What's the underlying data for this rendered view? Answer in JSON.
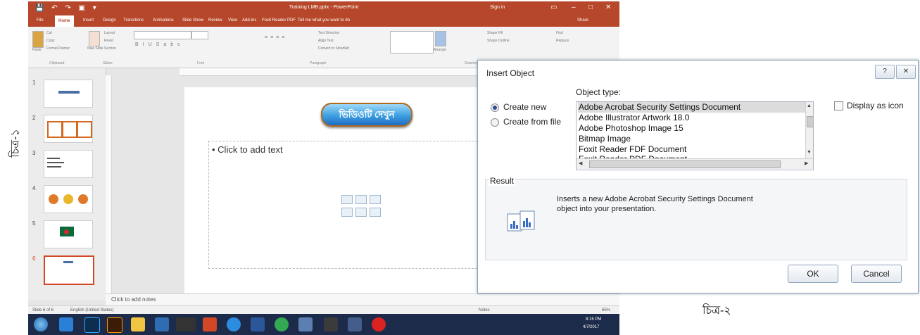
{
  "captions": {
    "fig1": "চিত্র-১",
    "fig2": "চিত্র-২"
  },
  "powerpoint": {
    "window_title": "Training LMB.pptx - PowerPoint",
    "sign_in": "Sign in",
    "tabs": [
      "File",
      "Home",
      "Insert",
      "Design",
      "Transitions",
      "Animations",
      "Slide Show",
      "Review",
      "View",
      "Add-ins",
      "Foxit Reader PDF",
      "Tell me what you want to do"
    ],
    "share": "Share",
    "ribbon": {
      "clipboard": {
        "cut": "Cut",
        "copy": "Copy",
        "format_painter": "Format Painter",
        "paste": "Paste",
        "label": "Clipboard"
      },
      "slides": {
        "new_slide": "New Slide",
        "layout": "Layout",
        "reset": "Reset",
        "section": "Section",
        "label": "Slides"
      },
      "font_label": "Font",
      "paragraph": {
        "text_direction": "Text Direction",
        "align_text": "Align Text",
        "convert_smartart": "Convert to SmartArt",
        "label": "Paragraph"
      },
      "drawing": {
        "arrange": "Arrange",
        "shape_fill": "Shape Fill",
        "shape_outline": "Shape Outline",
        "label": "Drawing"
      },
      "editing": {
        "find": "Find",
        "replace": "Replace"
      }
    },
    "slide_numbers": [
      "1",
      "2",
      "3",
      "4",
      "5",
      "6"
    ],
    "slide": {
      "video_button": "ভিডিওটি দেখুন",
      "placeholder_text": "• Click to add text"
    },
    "notes_placeholder": "Click to add notes",
    "status": {
      "slide_count": "Slide 6 of 6",
      "language": "English (United States)",
      "notes": "Notes",
      "zoom": "65%"
    },
    "taskbar_time": "8:15 PM",
    "taskbar_date": "4/7/2017"
  },
  "dialog": {
    "title": "Insert Object",
    "help_icon": "?",
    "object_type_label": "Object type:",
    "radio_create_new": "Create new",
    "radio_create_from_file": "Create from file",
    "display_as_icon": "Display as icon",
    "object_types": [
      "Adobe Acrobat Security Settings Document",
      "Adobe Illustrator Artwork 18.0",
      "Adobe Photoshop Image 15",
      "Bitmap Image",
      "Foxit Reader FDF Document",
      "Foxit Reader PDF Document"
    ],
    "selected_index": 0,
    "result_label": "Result",
    "result_text": "Inserts a new Adobe Acrobat Security Settings Document object into your presentation.",
    "ok": "OK",
    "cancel": "Cancel"
  }
}
